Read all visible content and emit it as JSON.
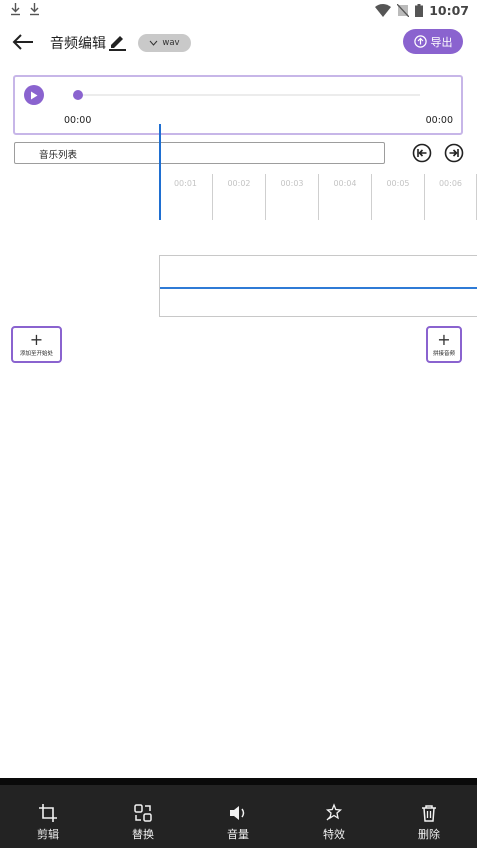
{
  "status_bar": {
    "time": "10:07",
    "icons": [
      "download-icon",
      "download-icon",
      "wifi-icon",
      "no-sim-icon",
      "battery-icon"
    ]
  },
  "header": {
    "title": "音频编辑",
    "format": "wav",
    "export_label": "导出"
  },
  "player": {
    "current_time": "00:00",
    "total_time": "00:00",
    "progress": 0
  },
  "music_list": {
    "label": "音乐列表"
  },
  "timeline": {
    "ticks": [
      "00:01",
      "00:02",
      "00:03",
      "00:04",
      "00:05",
      "00:06"
    ]
  },
  "actions": {
    "add_left_label": "添加至开始处",
    "add_right_label": "拼接音频"
  },
  "toolbar": {
    "items": [
      {
        "label": "剪辑",
        "icon": "crop-icon"
      },
      {
        "label": "替换",
        "icon": "replace-icon"
      },
      {
        "label": "音量",
        "icon": "volume-icon"
      },
      {
        "label": "特效",
        "icon": "effects-icon"
      },
      {
        "label": "删除",
        "icon": "delete-icon"
      }
    ]
  },
  "colors": {
    "accent": "#8a63cf",
    "playhead": "#1f6fd1",
    "toolbar_bg": "#232323"
  }
}
